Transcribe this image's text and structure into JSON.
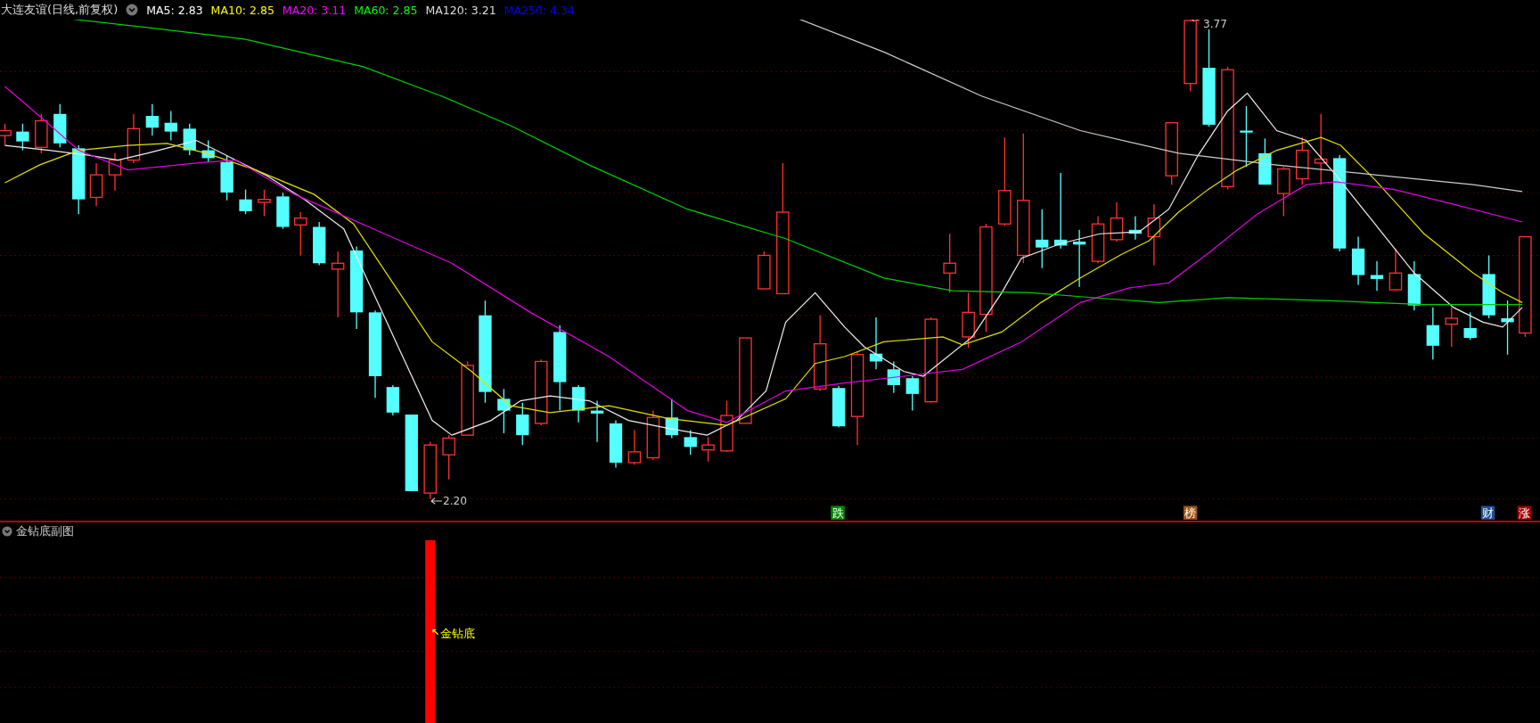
{
  "header": {
    "title": "大连友谊(日线,前复权)",
    "indicators": [
      {
        "label": "MA5: 2.83",
        "color": "#ffffff"
      },
      {
        "label": "MA10: 2.85",
        "color": "#ffff00"
      },
      {
        "label": "MA20: 3.11",
        "color": "#ff00ff"
      },
      {
        "label": "MA60: 2.85",
        "color": "#00ff00"
      },
      {
        "label": "MA120: 3.21",
        "color": "#dddddd"
      },
      {
        "label": "MA250: 4.34",
        "color": "#0000ff"
      }
    ]
  },
  "chart": {
    "high_label": "3.77",
    "low_label": "2.20",
    "event_markers": [
      {
        "label": "跌",
        "color": "#008800"
      },
      {
        "label": "榜",
        "color": "#a05010"
      },
      {
        "label": "财",
        "color": "#1f4f8f"
      },
      {
        "label": "涨",
        "color": "#a00000"
      }
    ]
  },
  "subchart": {
    "title": "金钻底副图",
    "signal_label": "金钻底"
  }
}
